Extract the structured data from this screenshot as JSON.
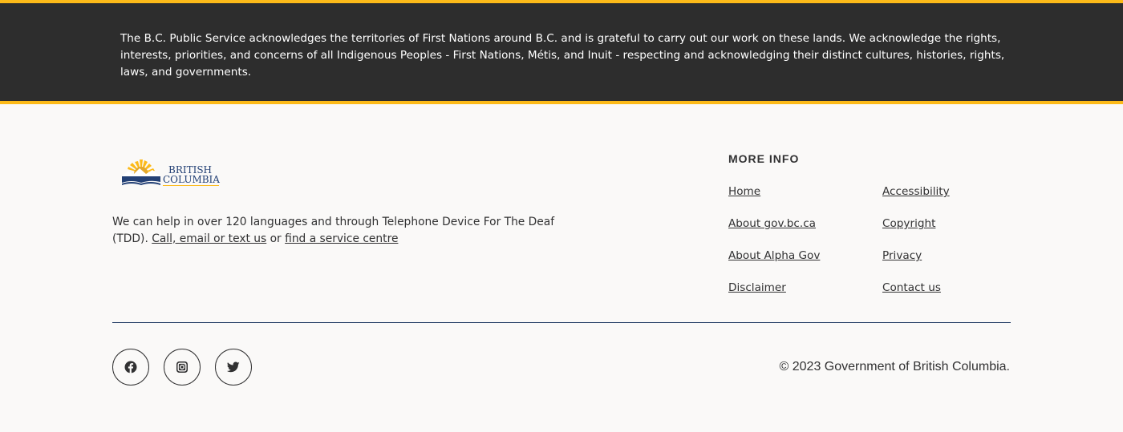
{
  "acknowledgement": {
    "text": "The B.C. Public Service acknowledges the territories of First Nations around B.C. and is grateful to carry out our work on these lands. We acknowledge the rights, interests, priorities, and concerns of all Indigenous Peoples - First Nations, Métis, and Inuit - respecting and acknowledging their distinct cultures, histories, rights, laws, and governments."
  },
  "logo": {
    "line1": "BRITISH",
    "line2": "COLUMBIA"
  },
  "help": {
    "text_before": "We can help in over 120 languages and through Telephone Device For The Deaf (TDD). ",
    "link1": "Call, email or text us",
    "text_middle": " or ",
    "link2": "find a service centre"
  },
  "more_info": {
    "title": "MORE INFO",
    "links": [
      "Home",
      "Accessibility",
      "About gov.bc.ca",
      "Copyright",
      "About Alpha Gov",
      "Privacy",
      "Disclaimer",
      "Contact us"
    ]
  },
  "social": {
    "icons": [
      "facebook-icon",
      "instagram-icon",
      "twitter-icon"
    ]
  },
  "copyright": "© 2023 Government of British Columbia.",
  "colors": {
    "accent_gold": "#fcba19",
    "dark_band": "#2d2d2d",
    "divider_navy": "#1f3a63",
    "background": "#faf9f8"
  }
}
